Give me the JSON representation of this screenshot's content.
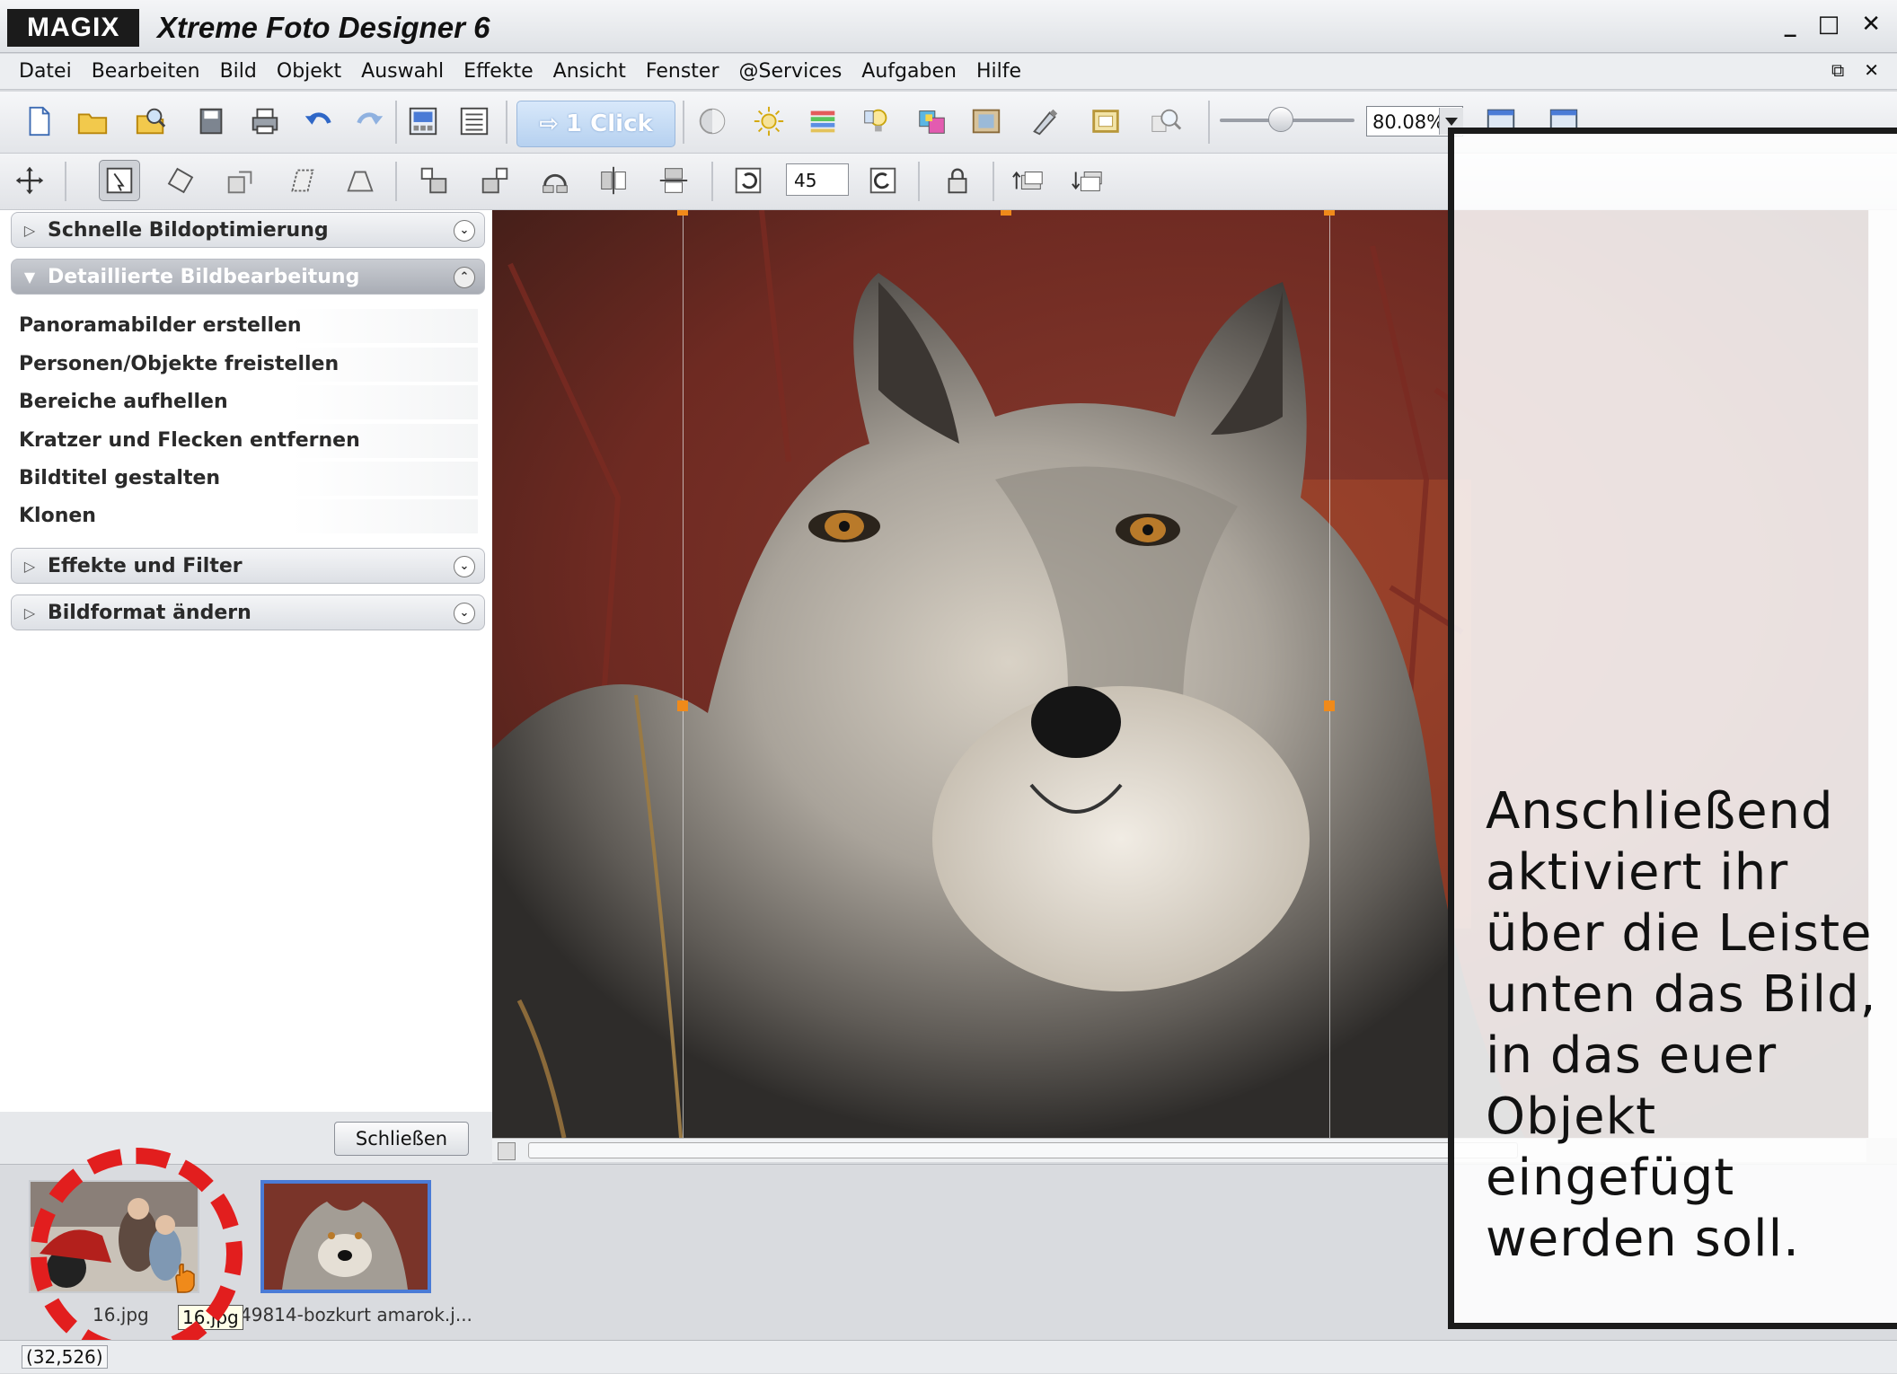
{
  "window": {
    "brand": "MAGIX",
    "title": "Xtreme Foto Designer 6",
    "controls": [
      "_",
      "□",
      "✕"
    ]
  },
  "menu": {
    "items": [
      "Datei",
      "Bearbeiten",
      "Bild",
      "Objekt",
      "Auswahl",
      "Effekte",
      "Ansicht",
      "Fenster",
      "@Services",
      "Aufgaben",
      "Hilfe"
    ],
    "right_controls": [
      "⧉",
      "✕"
    ]
  },
  "toolbar": {
    "one_click_label": "1 Click",
    "zoom_value": "80.08%",
    "rotation_angle": "45"
  },
  "sidebar": {
    "sections": [
      {
        "label": "Schnelle Bildoptimierung",
        "expanded": false
      },
      {
        "label": "Detaillierte Bildbearbeitung",
        "expanded": true
      },
      {
        "label": "Effekte und Filter",
        "expanded": false
      },
      {
        "label": "Bildformat ändern",
        "expanded": false
      }
    ],
    "items": [
      "Panoramabilder erstellen",
      "Personen/Objekte freistellen",
      "Bereiche aufhellen",
      "Kratzer und Flecken entfernen",
      "Bildtitel gestalten",
      "Klonen"
    ],
    "close_label": "Schließen"
  },
  "filmstrip": {
    "thumbs": [
      {
        "label": "16.jpg",
        "selected": false
      },
      {
        "label": "49814-bozkurt amarok.j...",
        "selected": true
      }
    ],
    "tooltip": "16.jpg"
  },
  "status": {
    "coords": "(32,526)"
  },
  "annotation": {
    "text": "Anschließend\naktiviert ihr\nüber die Leiste\nunten das Bild,\nin das euer\nObjekt\neingefügt\nwerden soll."
  },
  "colors": {
    "accent": "#4a7bd6",
    "highlight_ring": "#e21e1e",
    "overlay_border": "#1b1b1b"
  }
}
